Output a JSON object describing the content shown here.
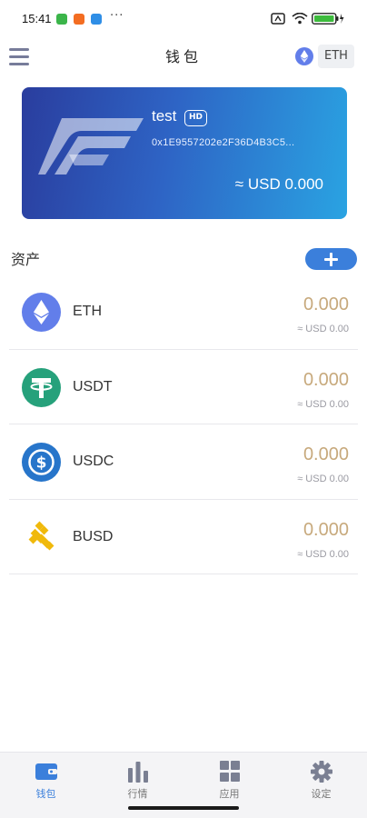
{
  "status_bar": {
    "time": "15:41",
    "dots": "···"
  },
  "header": {
    "title": "钱包",
    "network_label": "ETH"
  },
  "wallet": {
    "name": "test",
    "badge": "HD",
    "address": "0x1E9557202e2F36D4B3C5...",
    "balance": "≈ USD 0.000"
  },
  "assets": {
    "title": "资产",
    "items": [
      {
        "symbol": "ETH",
        "amount": "0.000",
        "usd": "≈ USD 0.00",
        "icon": "eth-icon",
        "color": "#627eea"
      },
      {
        "symbol": "USDT",
        "amount": "0.000",
        "usd": "≈ USD 0.00",
        "icon": "usdt-icon",
        "color": "#26a17b"
      },
      {
        "symbol": "USDC",
        "amount": "0.000",
        "usd": "≈ USD 0.00",
        "icon": "usdc-icon",
        "color": "#2775ca"
      },
      {
        "symbol": "BUSD",
        "amount": "0.000",
        "usd": "≈ USD 0.00",
        "icon": "busd-icon",
        "color": "#f0b90b"
      }
    ]
  },
  "nav": {
    "items": [
      {
        "label": "钱包",
        "icon": "wallet-icon",
        "active": true
      },
      {
        "label": "行情",
        "icon": "market-chart-icon",
        "active": false
      },
      {
        "label": "应用",
        "icon": "apps-grid-icon",
        "active": false
      },
      {
        "label": "设定",
        "icon": "settings-gear-icon",
        "active": false
      }
    ]
  },
  "colors": {
    "accent": "#3b7fdb",
    "amount": "#c7a97c",
    "card_start": "#2a3d9e",
    "card_end": "#2aa3e2"
  }
}
